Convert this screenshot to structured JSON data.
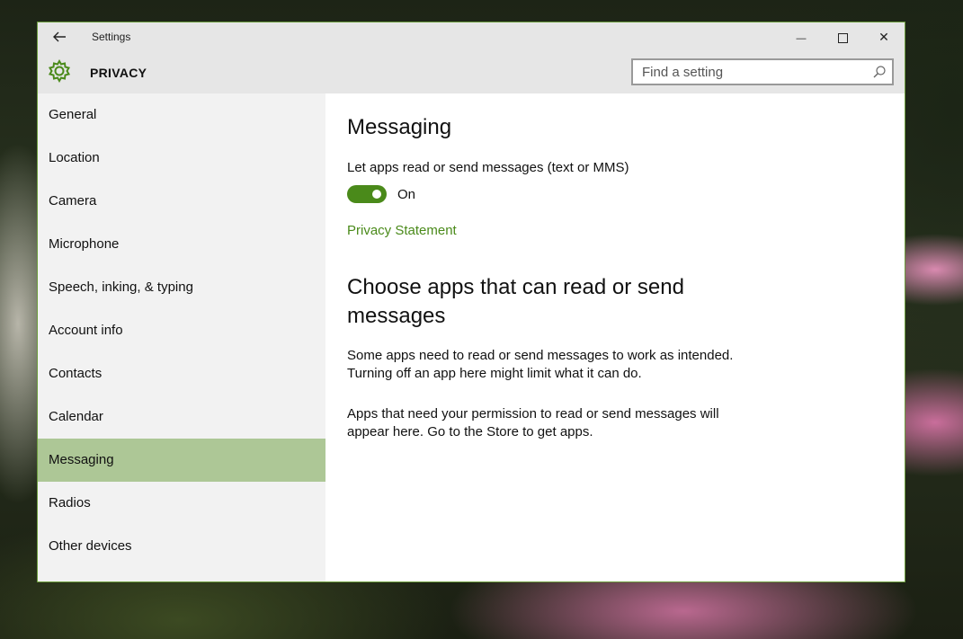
{
  "window": {
    "title": "Settings",
    "back_icon": "arrow-left-icon",
    "minimize_glyph": "—",
    "close_glyph": "✕"
  },
  "header": {
    "section": "PRIVACY",
    "icon": "gear-icon",
    "accent": "#4a8a1a"
  },
  "search": {
    "placeholder": "Find a setting"
  },
  "sidebar": {
    "items": [
      {
        "label": "General"
      },
      {
        "label": "Location"
      },
      {
        "label": "Camera"
      },
      {
        "label": "Microphone"
      },
      {
        "label": "Speech, inking, & typing"
      },
      {
        "label": "Account info"
      },
      {
        "label": "Contacts"
      },
      {
        "label": "Calendar"
      },
      {
        "label": "Messaging",
        "selected": true
      },
      {
        "label": "Radios"
      },
      {
        "label": "Other devices"
      }
    ],
    "selected_color": "#adc796"
  },
  "main": {
    "title": "Messaging",
    "toggle_label": "Let apps read or send messages (text or MMS)",
    "toggle_state": "On",
    "toggle_on": true,
    "privacy_link": "Privacy Statement",
    "section_title": "Choose apps that can read or send messages",
    "paragraph1": "Some apps need to read or send messages to work as intended. Turning off an app here might limit what it can do.",
    "paragraph2": "Apps that need your permission to read or send messages will appear here. Go to the Store to get apps."
  }
}
